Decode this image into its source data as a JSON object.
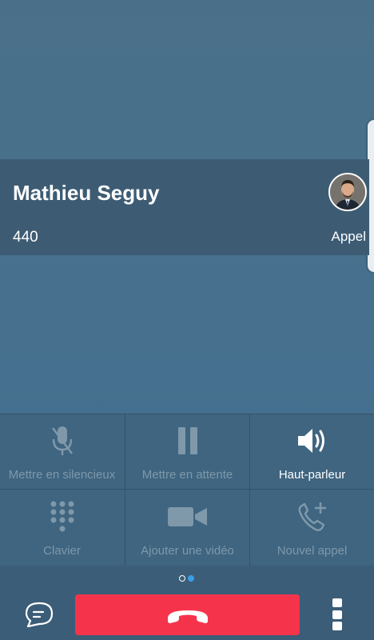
{
  "call": {
    "contact_name": "Mathieu Seguy",
    "number": "440",
    "call_type": "Appel"
  },
  "controls": {
    "mute": {
      "label": "Mettre en silencieux",
      "icon": "microphone-off-icon",
      "enabled": false
    },
    "hold": {
      "label": "Mettre en attente",
      "icon": "pause-icon",
      "enabled": false
    },
    "speaker": {
      "label": "Haut-parleur",
      "icon": "speaker-icon",
      "enabled": true
    },
    "keypad": {
      "label": "Clavier",
      "icon": "keypad-icon",
      "enabled": false
    },
    "video": {
      "label": "Ajouter une vidéo",
      "icon": "video-camera-icon",
      "enabled": false
    },
    "new_call": {
      "label": "Nouvel appel",
      "icon": "add-call-icon",
      "enabled": false
    }
  },
  "pager": {
    "pages": 2,
    "current": 2
  },
  "bottom": {
    "chat_icon": "chat-icon",
    "end_icon": "hang-up-icon",
    "more_icon": "more-vertical-icon"
  },
  "colors": {
    "background": "#46708c",
    "card": "#3d5c74",
    "end_call": "#f5344b",
    "disabled_text": "#7f98aa",
    "pager_active": "#3aa0e6"
  }
}
